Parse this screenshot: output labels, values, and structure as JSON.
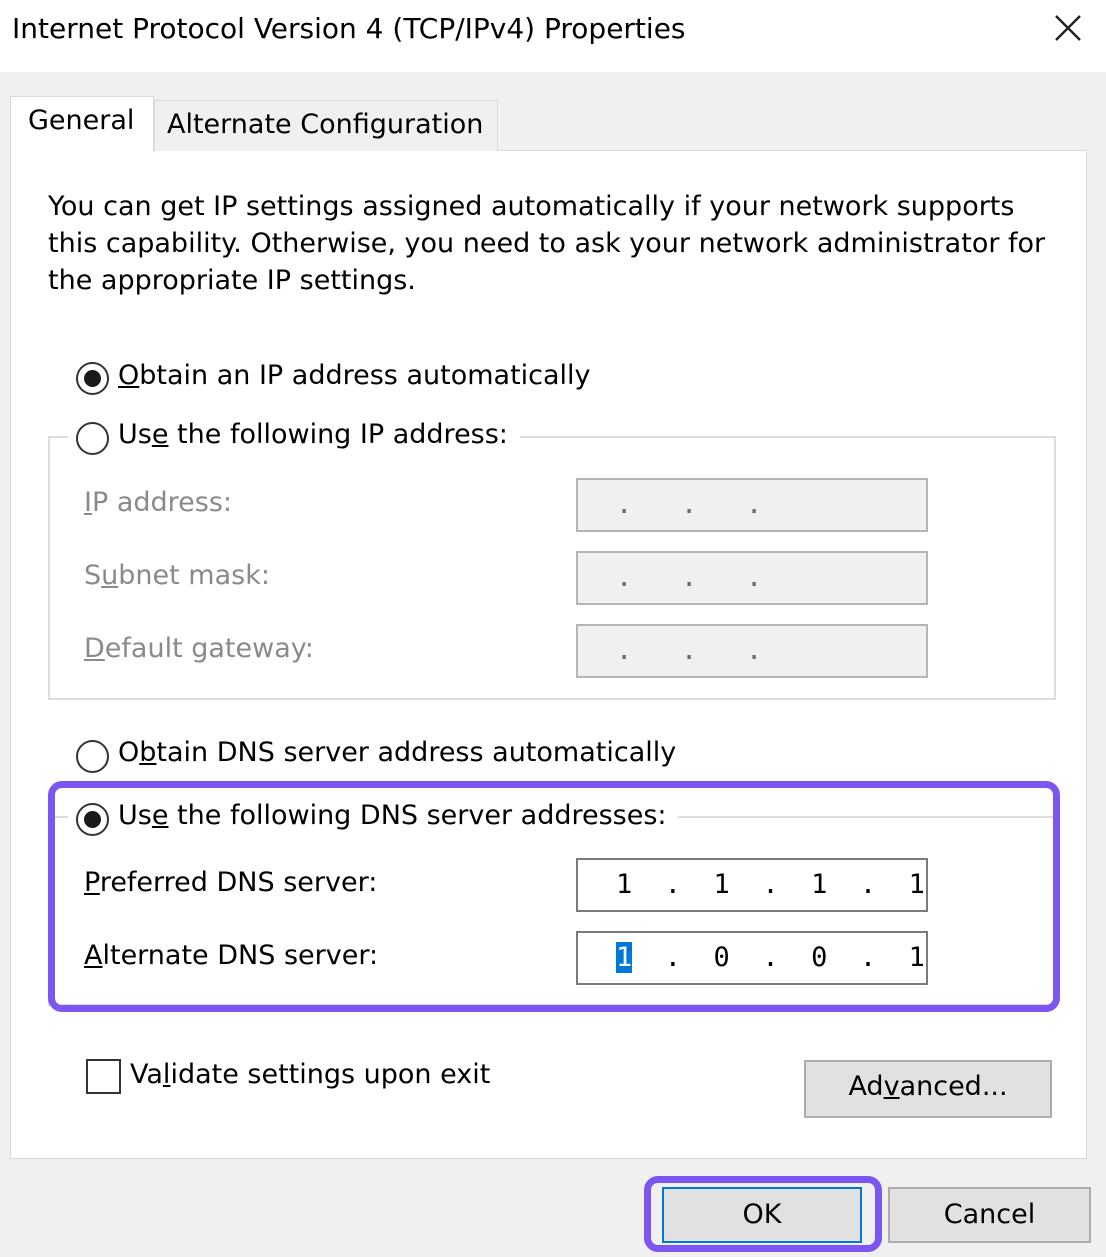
{
  "window": {
    "title": "Internet Protocol Version 4 (TCP/IPv4) Properties",
    "close_icon": "close-icon"
  },
  "tabs": [
    {
      "label": "General",
      "selected": true
    },
    {
      "label": "Alternate Configuration",
      "selected": false
    }
  ],
  "description": "You can get IP settings assigned automatically if your network supports this capability. Otherwise, you need to ask your network administrator for the appropriate IP settings.",
  "ip": {
    "auto_label": {
      "pre": "",
      "key": "O",
      "post": "btain an IP address automatically"
    },
    "auto_selected": true,
    "manual_label": {
      "pre": "Us",
      "key": "e",
      "post": " the following IP address:"
    },
    "manual_selected": false,
    "fields": [
      {
        "label": {
          "pre": "",
          "key": "I",
          "post": "P address:"
        },
        "value": ".   .   .",
        "enabled": false
      },
      {
        "label": {
          "pre": "S",
          "key": "u",
          "post": "bnet mask:"
        },
        "value": ".   .   .",
        "enabled": false
      },
      {
        "label": {
          "pre": "",
          "key": "D",
          "post": "efault gateway:"
        },
        "value": ".   .   .",
        "enabled": false
      }
    ]
  },
  "dns": {
    "auto_label": {
      "pre": "O",
      "key": "b",
      "post": "tain DNS server address automatically"
    },
    "auto_selected": false,
    "manual_label": {
      "pre": "Us",
      "key": "e",
      "post": " the following DNS server addresses:"
    },
    "manual_selected": true,
    "preferred": {
      "label": {
        "pre": "",
        "key": "P",
        "post": "referred DNS server:"
      },
      "octets": [
        "1",
        "1",
        "1",
        "1"
      ]
    },
    "alternate": {
      "label": {
        "pre": "",
        "key": "A",
        "post": "lternate DNS server:"
      },
      "octets": [
        "1",
        "0",
        "0",
        "1"
      ],
      "selected_octet": 0
    }
  },
  "validate": {
    "label": {
      "pre": "Va",
      "key": "l",
      "post": "idate settings upon exit"
    },
    "checked": false
  },
  "buttons": {
    "advanced": {
      "pre": "Ad",
      "key": "v",
      "post": "anced..."
    },
    "ok": "OK",
    "cancel": "Cancel"
  },
  "colors": {
    "highlight": "#7b57f0",
    "selection": "#0078d7"
  }
}
